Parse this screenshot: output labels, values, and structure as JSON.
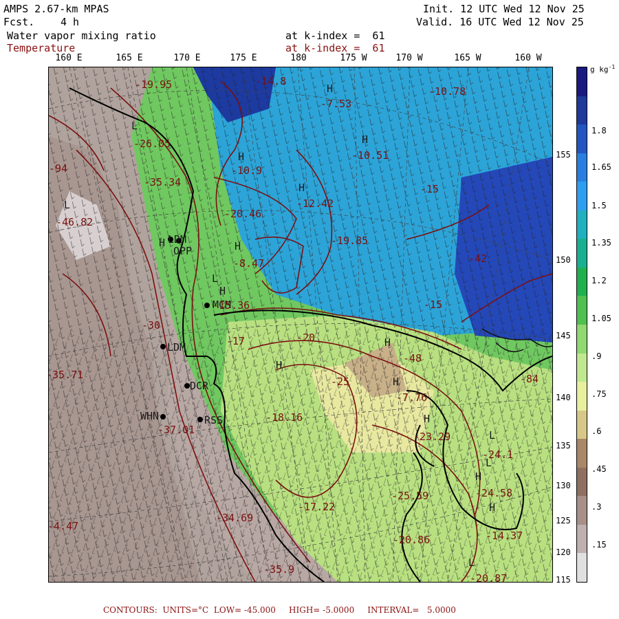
{
  "header": {
    "model": "AMPS 2.67-km MPAS",
    "forecast_label": "Fcst.",
    "forecast_value": "4 h",
    "field1": "Water vapor mixing ratio",
    "field1_level": "at k-index =  61",
    "field2": "Temperature",
    "field2_level": "at k-index =  61",
    "init": "Init. 12 UTC Wed 12 Nov 25",
    "valid": "Valid. 16 UTC Wed 12 Nov 25"
  },
  "longitude_labels": [
    "160 E",
    "165 E",
    "170 E",
    "175 E",
    "180",
    "175 W",
    "170 W",
    "165 W",
    "160 W"
  ],
  "latitude_labels": [
    "155",
    "150",
    "145",
    "140",
    "135",
    "130",
    "125",
    "120",
    "115"
  ],
  "colorbar": {
    "unit": "g kg",
    "unit_exp": "-1",
    "labels": [
      "1.8",
      "1.65",
      "1.5",
      "1.35",
      "1.2",
      "1.05",
      ".9",
      ".75",
      ".6",
      ".45",
      ".3",
      ".15"
    ],
    "colors": [
      "#1a1a80",
      "#1e3a9a",
      "#2256c0",
      "#2a7ee0",
      "#2e9ef0",
      "#20b0c0",
      "#18b090",
      "#20b050",
      "#50c050",
      "#90d870",
      "#c0e890",
      "#e8f0a0",
      "#d8c888",
      "#a88868",
      "#907060",
      "#a89088",
      "#c0b0b0",
      "#e0e0e0"
    ]
  },
  "contour_labels": [
    {
      "text": "-19.95",
      "color": "red"
    },
    {
      "text": "-14.8",
      "color": "red"
    },
    {
      "text": "-10.78",
      "color": "red"
    },
    {
      "text": "-7.53",
      "color": "red"
    },
    {
      "text": "-26.05",
      "color": "red"
    },
    {
      "text": "-10.9",
      "color": "red"
    },
    {
      "text": "-10.51",
      "color": "red"
    },
    {
      "text": "-35.34",
      "color": "red"
    },
    {
      "text": "-12.42",
      "color": "red"
    },
    {
      "text": "-15",
      "color": "red"
    },
    {
      "text": "-46.82",
      "color": "red"
    },
    {
      "text": "-20.46",
      "color": "red"
    },
    {
      "text": "-19.85",
      "color": "red"
    },
    {
      "text": "-8.47",
      "color": "red"
    },
    {
      "text": "-42",
      "color": "red"
    },
    {
      "text": "-15.36",
      "color": "red"
    },
    {
      "text": "-15",
      "color": "red"
    },
    {
      "text": "-30",
      "color": "red"
    },
    {
      "text": "-17",
      "color": "red"
    },
    {
      "text": "-20",
      "color": "red"
    },
    {
      "text": "-48",
      "color": "red"
    },
    {
      "text": "-35.71",
      "color": "red"
    },
    {
      "text": "-25",
      "color": "red"
    },
    {
      "text": "-7.76",
      "color": "red"
    },
    {
      "text": "-18.16",
      "color": "red"
    },
    {
      "text": "-37.01",
      "color": "red"
    },
    {
      "text": "-23.29",
      "color": "red"
    },
    {
      "text": "-24.1",
      "color": "red"
    },
    {
      "text": "-24.58",
      "color": "red"
    },
    {
      "text": "-25.59",
      "color": "red"
    },
    {
      "text": "-34.69",
      "color": "red"
    },
    {
      "text": "-17.22",
      "color": "red"
    },
    {
      "text": "-14.37",
      "color": "red"
    },
    {
      "text": "-4.47",
      "color": "red"
    },
    {
      "text": "-20.86",
      "color": "red"
    },
    {
      "text": "-35.9",
      "color": "red"
    },
    {
      "text": "-20.87",
      "color": "red"
    },
    {
      "text": "-94",
      "color": "red"
    },
    {
      "text": "-84",
      "color": "red"
    }
  ],
  "station_labels": [
    "LDM",
    "OPP",
    "MCM",
    "LDM",
    "DCR",
    "WHN",
    "RSS"
  ],
  "footer": {
    "contours": "CONTOURS:",
    "units": "UNITS=°C",
    "low": "LOW= -45.000",
    "high": "HIGH= -5.0000",
    "interval": "INTERVAL=   5.0000"
  }
}
